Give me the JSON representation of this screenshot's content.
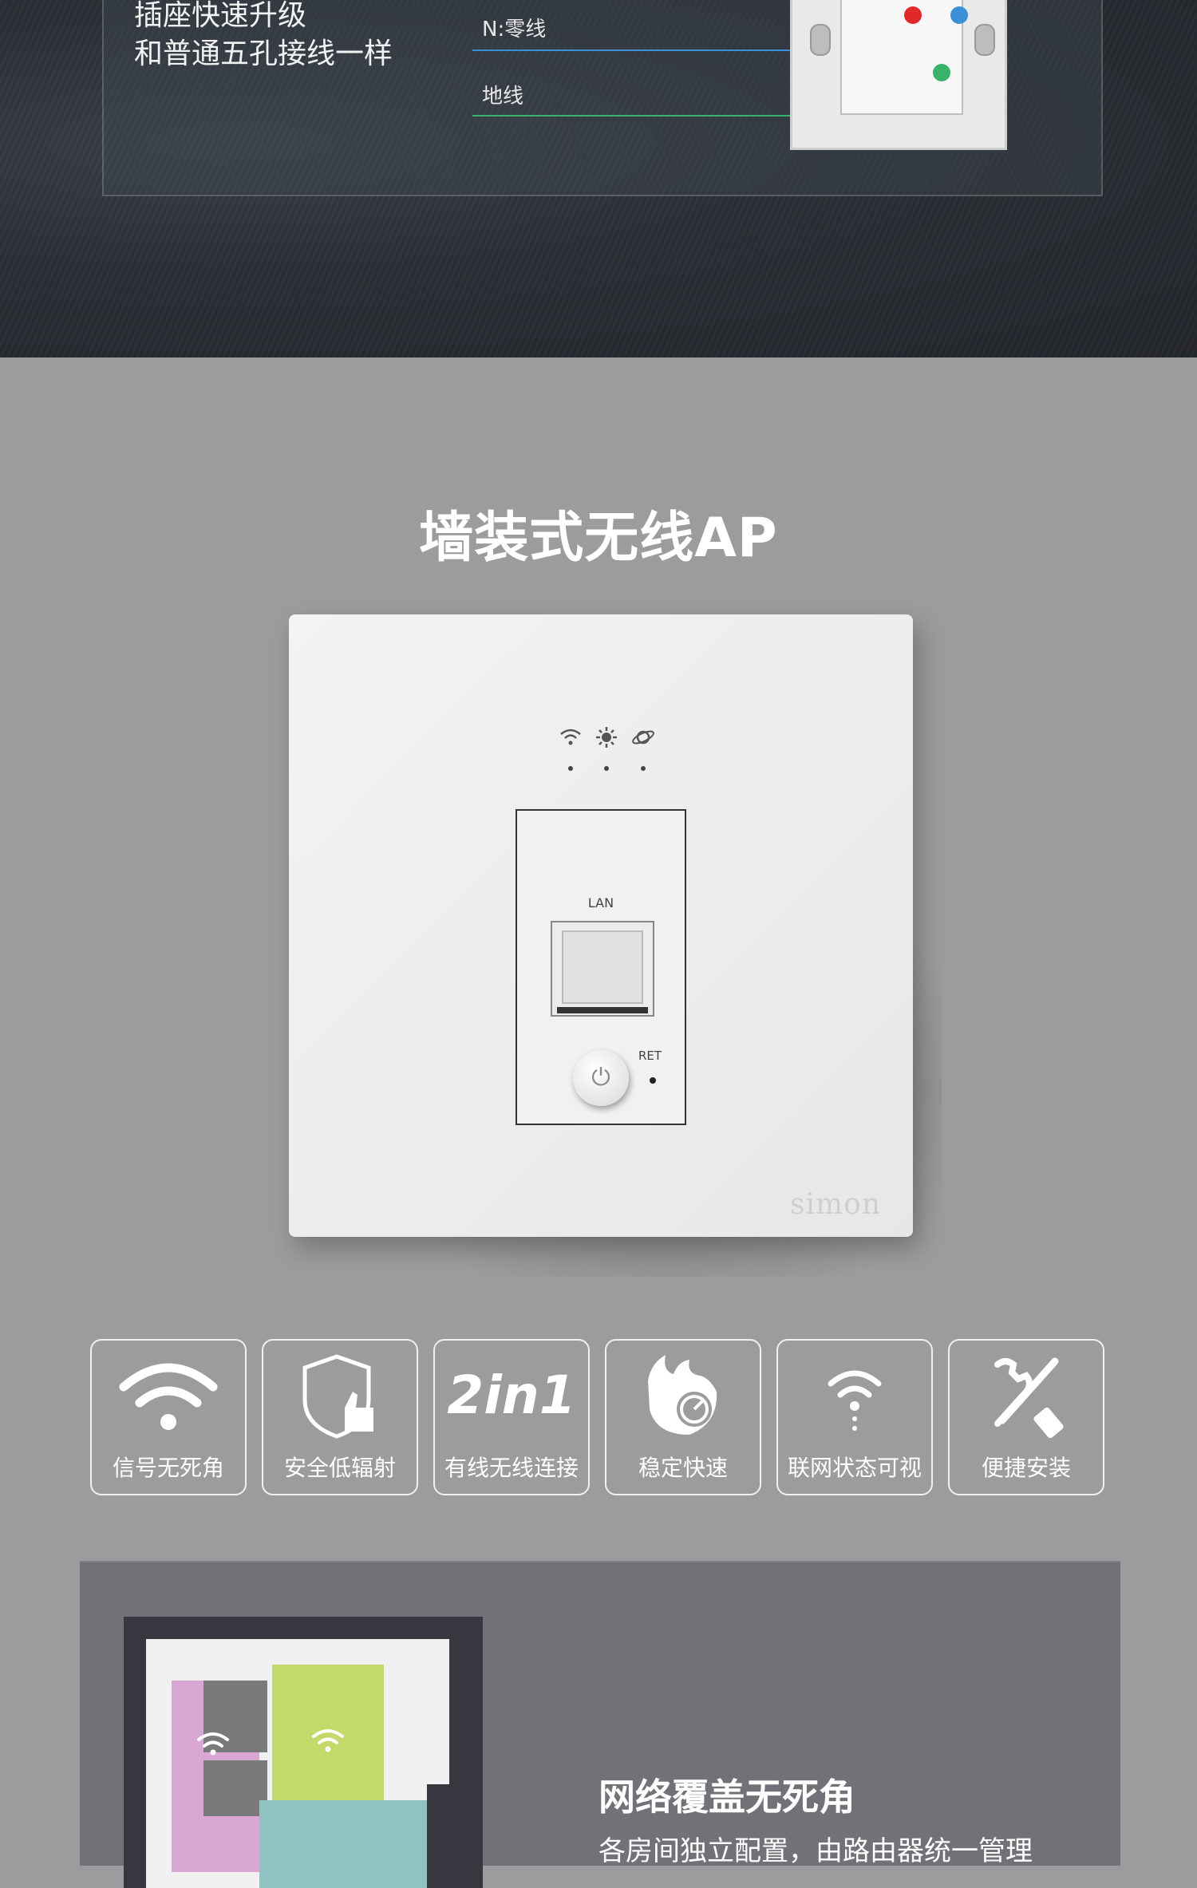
{
  "wiring": {
    "line1": "插座快速升级",
    "line2": "和普通五孔接线一样",
    "neutral_label": "N:零线",
    "ground_label": "地线",
    "colors": {
      "neutral": "#3a8fd6",
      "ground": "#39b36b",
      "live": "#e02a2a"
    }
  },
  "ap": {
    "title": "墙装式无线AP",
    "led_icons": [
      "wifi-icon",
      "sun-icon",
      "planet-icon"
    ],
    "lan_label": "LAN",
    "ret_label": "RET",
    "power_glyph": "⏻",
    "brand": "simon"
  },
  "features": [
    {
      "icon": "wifi-icon",
      "label": "信号无死角"
    },
    {
      "icon": "shield-thumb-icon",
      "label": "安全低辐射"
    },
    {
      "icon": "2in1-icon",
      "label": "有线无线连接",
      "icon_text": "2in1"
    },
    {
      "icon": "speed-flame-icon",
      "label": "稳定快速"
    },
    {
      "icon": "wifi-status-icon",
      "label": "联网状态可视"
    },
    {
      "icon": "tools-icon",
      "label": "便捷安装"
    }
  ],
  "coverage": {
    "title": "网络覆盖无死角",
    "subtitle": "各房间独立配置，由路由器统一管理"
  }
}
